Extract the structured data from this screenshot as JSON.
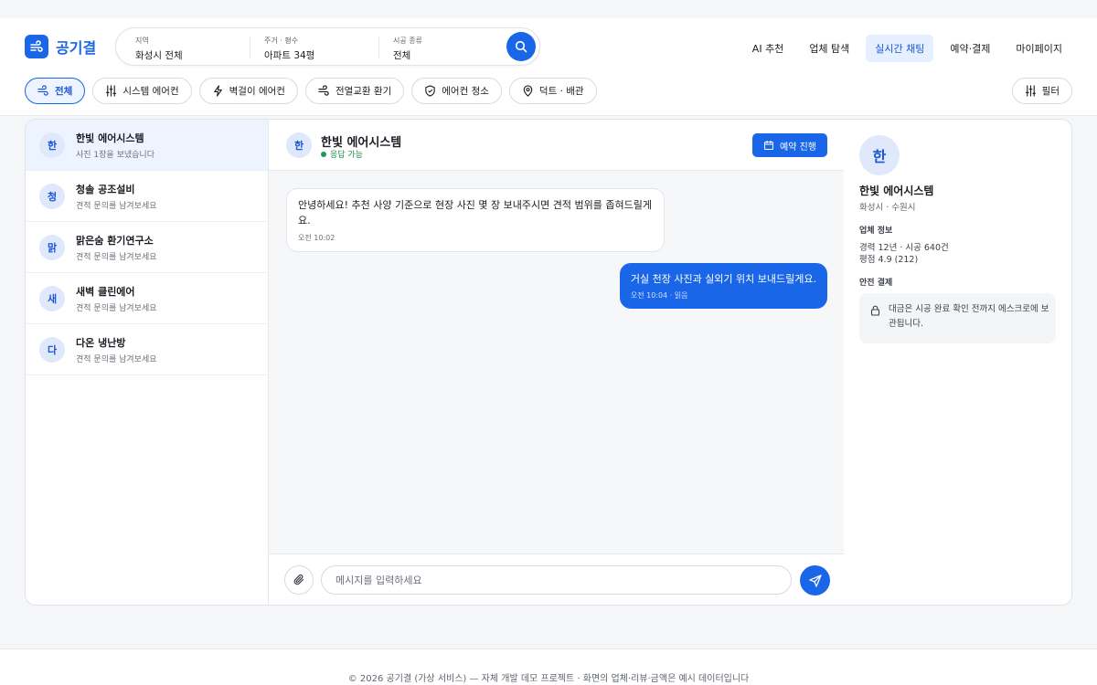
{
  "app": {
    "name": "공기결",
    "brand_color": "#1a66e8"
  },
  "search": {
    "region_label": "지역",
    "region_value": "화성시 전체",
    "housing_label": "주거 · 평수",
    "housing_value": "아파트 34평",
    "work_label": "시공 종류",
    "work_value": "전체",
    "icon": "search-icon"
  },
  "nav": {
    "items": [
      {
        "label": "AI 추천"
      },
      {
        "label": "업체 탐색"
      },
      {
        "label": "실시간 채팅",
        "active": true
      },
      {
        "label": "예약·결제"
      },
      {
        "label": "마이페이지"
      }
    ]
  },
  "chips": [
    {
      "label": "전체",
      "icon": "wind-icon",
      "active": true
    },
    {
      "label": "시스템 에어컨",
      "icon": "sliders-icon"
    },
    {
      "label": "벽걸이 에어컨",
      "icon": "bolt-icon"
    },
    {
      "label": "전열교환 환기",
      "icon": "wind-icon"
    },
    {
      "label": "에어컨 청소",
      "icon": "shield-icon"
    },
    {
      "label": "덕트 · 배관",
      "icon": "pin-icon"
    }
  ],
  "filter_label": "필터",
  "conversations": [
    {
      "initial": "한",
      "name": "한빛 에어시스템",
      "preview": "사진 1장을 보냈습니다",
      "active": true
    },
    {
      "initial": "청",
      "name": "청솔 공조설비",
      "preview": "견적 문의를 남겨보세요"
    },
    {
      "initial": "맑",
      "name": "맑은숨 환기연구소",
      "preview": "견적 문의를 남겨보세요"
    },
    {
      "initial": "새",
      "name": "새벽 클린에어",
      "preview": "견적 문의를 남겨보세요"
    },
    {
      "initial": "다",
      "name": "다온 냉난방",
      "preview": "견적 문의를 남겨보세요"
    }
  ],
  "chat": {
    "initial": "한",
    "name": "한빛 에어시스템",
    "status": "응답 가능",
    "book_label": "예약 진행",
    "messages": [
      {
        "direction": "in",
        "text": "안녕하세요! 추천 사양 기준으로 현장 사진 몇 장 보내주시면 견적 범위를 좁혀드릴게요.",
        "time": "오전 10:02"
      },
      {
        "direction": "out",
        "text": "거실 천장 사진과 실외기 위치 보내드릴게요.",
        "time": "오전 10:04 · 읽음"
      }
    ],
    "input_placeholder": "메시지를 입력하세요"
  },
  "info": {
    "initial": "한",
    "name": "한빛 에어시스템",
    "location": "화성시 · 수원시",
    "company_heading": "업체 정보",
    "experience": "경력 12년 · 시공 640건",
    "rating": "평점 4.9 (212)",
    "safe_heading": "안전 결제",
    "escrow_text": "대금은 시공 완료 확인 전까지 에스크로에 보관됩니다."
  },
  "footer": "© 2026 공기결 (가상 서비스) — 자체 개발 데모 프로젝트 · 화면의 업체·리뷰·금액은 예시 데이터입니다"
}
